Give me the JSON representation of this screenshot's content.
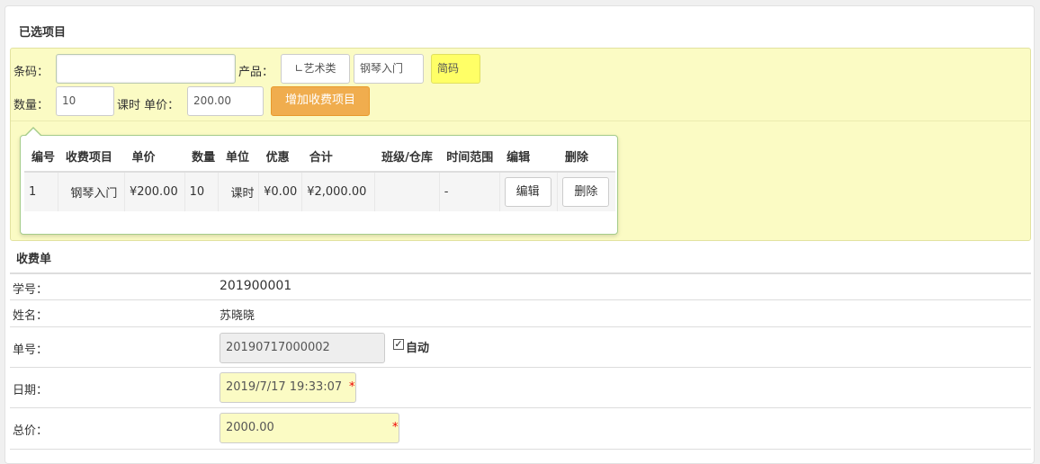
{
  "selected": {
    "title": "已选项目",
    "barcode_label": "条码：",
    "barcode_value": "",
    "product_label": "产品：",
    "product_category": "∟艺术类",
    "product_name": "钢琴入门",
    "short_code": "简码",
    "quantity_label": "数量：",
    "quantity_value": "10",
    "unit_label": "课时 单价：",
    "price_value": "200.00",
    "add_button": "增加收费项目"
  },
  "items_table": {
    "headers": [
      "编号",
      "收费项目",
      "单价",
      "数量",
      "单位",
      "优惠",
      "合计",
      "班级/仓库",
      "时间范围",
      "编辑",
      "删除"
    ],
    "rows": [
      {
        "no": "1",
        "item": "钢琴入门",
        "price": "¥200.00",
        "qty": "10",
        "unit": "课时",
        "discount": "¥0.00",
        "total": "¥2,000.00",
        "class": "",
        "range": "-",
        "edit": "编辑",
        "delete": "删除"
      }
    ]
  },
  "invoice": {
    "title": "收费单",
    "student_no_label": "学号：",
    "student_no": "201900001",
    "name_label": "姓名：",
    "name": "苏晓晓",
    "order_no_label": "单号：",
    "order_no": "20190717000002",
    "auto_label": "自动",
    "auto_checked": true,
    "date_label": "日期：",
    "date": "2019/7/17 19:33:07",
    "total_label": "总价：",
    "total": "2000.00",
    "required_mark": "*"
  }
}
